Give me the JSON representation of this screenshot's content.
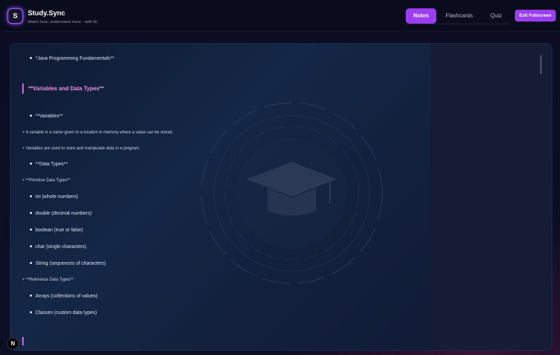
{
  "header": {
    "logo_letter": "S",
    "title": "Study.Sync",
    "tagline": "Watch less, understand more - with AI.",
    "tabs": [
      "Notes",
      "Flashcards",
      "Quiz"
    ],
    "active_tab": "Notes",
    "exit_label": "Exit Fullscreen"
  },
  "notes": {
    "intro_bullet": "*Java Programming Fundamentals**",
    "heading": "**Variables and Data Types**",
    "variables_bullet": "**Variables**",
    "variables_sub1": "+ A variable is a name given to a location in memory where a value can be stored.",
    "variables_sub2": "+ Variables are used to store and manipulate data in a program.",
    "data_types_bullet": "**Data Types**",
    "primitive_sub": "+ **Primitive Data Types**",
    "primitive_items": [
      "int (whole numbers)",
      "double (decimal numbers)",
      "boolean (true or false)",
      "char (single characters)",
      "String (sequences of characters)"
    ],
    "reference_sub": "+ **Reference Data Types**",
    "reference_items": [
      "Arrays (collections of values)",
      "Classes (custom data types)"
    ]
  },
  "overlay": {
    "badge": "N"
  },
  "colors": {
    "accent": "#9b3df0",
    "heading": "#ec8ee6",
    "background": "#0a0b1a"
  }
}
